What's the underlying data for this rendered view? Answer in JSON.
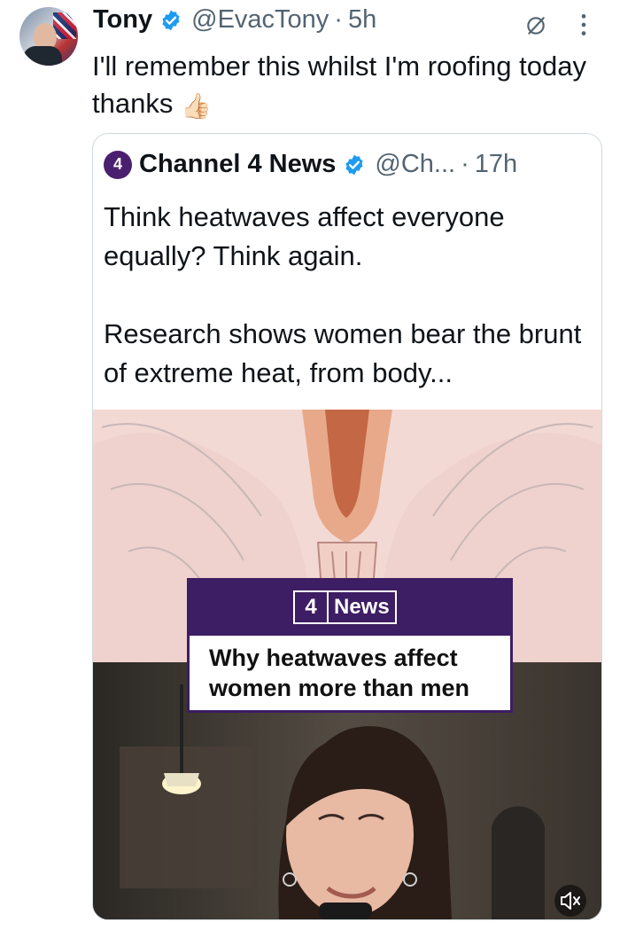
{
  "tweet": {
    "author_name": "Tony",
    "handle": "@EvacTony",
    "separator": "·",
    "time": "5h",
    "text": "I'll remember this whilst I'm roofing today thanks",
    "emoji": "👍🏻"
  },
  "quote": {
    "logo_text": "4",
    "author_name": "Channel 4 News",
    "handle": "@Ch...",
    "separator": "·",
    "time": "17h",
    "text_line1": "Think heatwaves affect everyone equally? Think again.",
    "text_line2": "Research shows women bear the brunt of extreme heat, from body...",
    "media": {
      "brand_number": "4",
      "brand_word": "News",
      "headline": "Why heatwaves affect women more than men"
    }
  },
  "icons": {
    "verified": "verified-badge-icon",
    "grok": "grok-icon",
    "more": "more-vertical-icon",
    "mute": "volume-muted-icon"
  },
  "colors": {
    "verified": "#1d9bf0",
    "secondary_text": "#536471",
    "channel4_purple": "#3d1d63"
  }
}
